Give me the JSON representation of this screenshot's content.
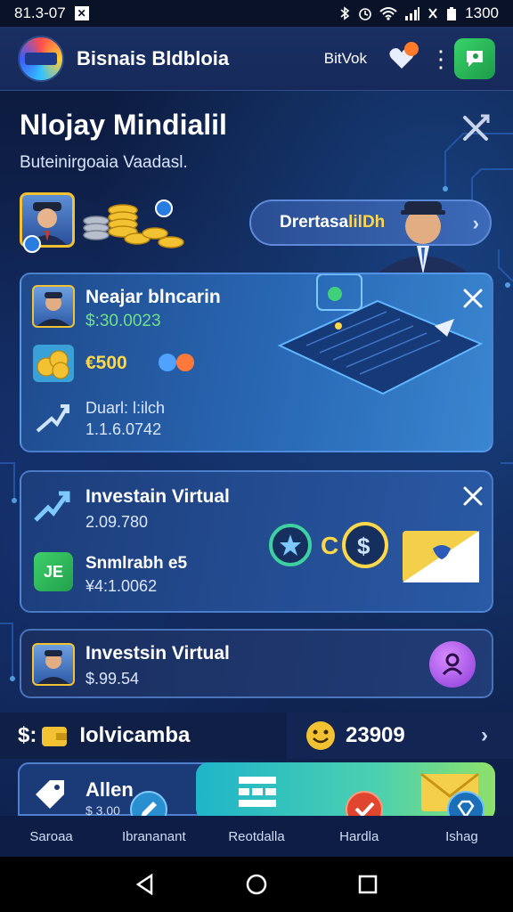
{
  "status_bar": {
    "time_left": "81.3-07",
    "time_right": "1300"
  },
  "app_bar": {
    "title": "Bisnais Bldbloia",
    "link": "BitVok"
  },
  "header": {
    "title": "Nlojay Mindialil",
    "subtitle": "Buteinirgoaia Vaadasl."
  },
  "promo_button": {
    "label_main": "Drertasa",
    "label_highlight": "lilDh"
  },
  "card_market": {
    "title": "Neajar blncarin",
    "amount": "$:30.0023",
    "coin_value": "€500",
    "label": "Duarl: l:ilch",
    "value": "1.1.6.0742"
  },
  "card_invest": {
    "title": "Investain Virtual",
    "value": "2.09.780",
    "sub_title": "Snmlrabh e5",
    "sub_value": "¥4:1.0062"
  },
  "card_virtual": {
    "title": "Investsin Virtual",
    "value": "$.99.54"
  },
  "summary_row": {
    "left_prefix": "$:",
    "left_label": "Iolvicamba",
    "right_value": "23909"
  },
  "promo_strip": {
    "left_label": "Allen",
    "left_value": "$ 3.00"
  },
  "tabs": [
    {
      "label": "Saroaa"
    },
    {
      "label": "Ibrananant"
    },
    {
      "label": "Reotdalla"
    },
    {
      "label": "Hardla"
    },
    {
      "label": "Ishag"
    }
  ],
  "colors": {
    "accent_gold": "#ffd84a",
    "accent_green": "#6fe08a",
    "background": "#0c1a3c"
  }
}
